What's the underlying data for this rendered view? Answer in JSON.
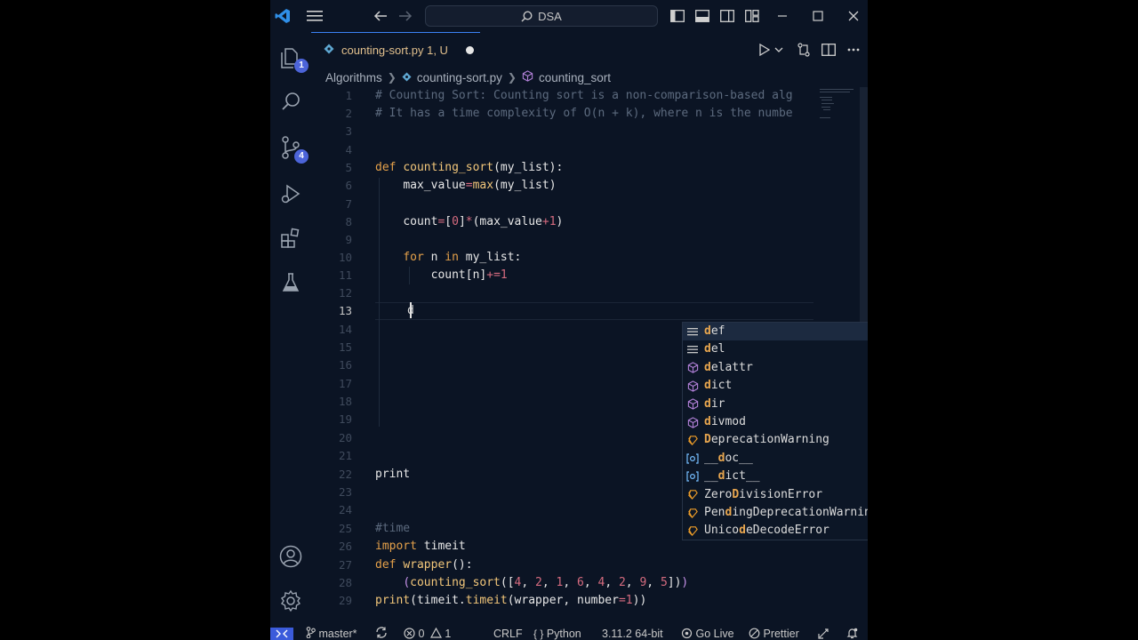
{
  "titlebar": {
    "search_text": "DSA"
  },
  "activity_bar": {
    "explorer_badge": "1",
    "scm_badge": "4"
  },
  "tab": {
    "label": "counting-sort.py 1, U"
  },
  "breadcrumb": {
    "folder": "Algorithms",
    "file": "counting-sort.py",
    "symbol": "counting_sort"
  },
  "editor": {
    "line_numbers": [
      "1",
      "2",
      "3",
      "4",
      "5",
      "6",
      "7",
      "8",
      "9",
      "10",
      "11",
      "12",
      "13",
      "14",
      "15",
      "16",
      "17",
      "18",
      "19",
      "20",
      "21",
      "22",
      "23",
      "24",
      "25",
      "26",
      "27",
      "28",
      "29"
    ],
    "active_line": "13",
    "comment_1": "# Counting Sort: Counting sort is a non-comparison-based alg",
    "comment_2": "# It has a time complexity of O(n + k), where n is the numbe",
    "typed_char": "d",
    "line22_visible": "print",
    "line25_visible": "#time",
    "line26": "import timeit",
    "line27": "def wrapper():",
    "line28": "    (counting_sort([4, 2, 1, 6, 4, 2, 9, 5]))",
    "line29": "print(timeit.timeit(wrapper, number=1))"
  },
  "suggestions": [
    {
      "label": "def",
      "kind": "keyword"
    },
    {
      "label": "del",
      "kind": "keyword"
    },
    {
      "label": "delattr",
      "kind": "function"
    },
    {
      "label": "dict",
      "kind": "class"
    },
    {
      "label": "dir",
      "kind": "function"
    },
    {
      "label": "divmod",
      "kind": "function"
    },
    {
      "label": "DeprecationWarning",
      "kind": "class-warning"
    },
    {
      "label": "__doc__",
      "kind": "variable"
    },
    {
      "label": "__dict__",
      "kind": "variable"
    },
    {
      "label": "ZeroDivisionError",
      "kind": "class-warning"
    },
    {
      "label": "PendingDeprecationWarning",
      "kind": "class-warning"
    },
    {
      "label": "UnicodeDecodeError",
      "kind": "class-warning"
    }
  ],
  "statusbar": {
    "branch": "master*",
    "errors": "0",
    "warnings": "1",
    "eol": "CRLF",
    "language": "Python",
    "interpreter": "3.11.2 64-bit",
    "golive": "Go Live",
    "prettier": "Prettier"
  },
  "colors": {
    "background": "#0b1424",
    "accent": "#3b82f6",
    "badge": "#4c64d9",
    "keyword": "#e5a14a",
    "function": "#f3c77a"
  }
}
